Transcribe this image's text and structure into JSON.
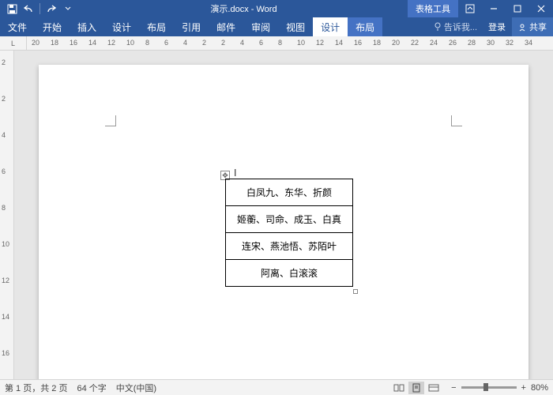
{
  "titlebar": {
    "document_title": "演示.docx - Word",
    "context_tool": "表格工具"
  },
  "ribbon": {
    "tabs": [
      "文件",
      "开始",
      "插入",
      "设计",
      "布局",
      "引用",
      "邮件",
      "审阅",
      "视图"
    ],
    "context_tabs": [
      "设计",
      "布局"
    ],
    "tell_me": "告诉我...",
    "login": "登录",
    "share": "共享"
  },
  "ruler": {
    "h_numbers": [
      "20",
      "18",
      "16",
      "14",
      "12",
      "10",
      "8",
      "6",
      "4",
      "2",
      "2",
      "4",
      "6",
      "8",
      "10",
      "12",
      "14",
      "16",
      "18",
      "20",
      "22",
      "24",
      "26",
      "28",
      "30",
      "32",
      "34"
    ],
    "v_numbers": [
      "2",
      "2",
      "4",
      "6",
      "8",
      "10",
      "12",
      "14",
      "16"
    ]
  },
  "table": {
    "rows": [
      "白凤九、东华、折颜",
      "姬蘅、司命、成玉、白真",
      "连宋、燕池悟、苏陌叶",
      "阿离、白滚滚"
    ]
  },
  "statusbar": {
    "page_info": "第 1 页，共 2 页",
    "word_count": "64 个字",
    "language": "中文(中国)",
    "zoom": "80%"
  }
}
